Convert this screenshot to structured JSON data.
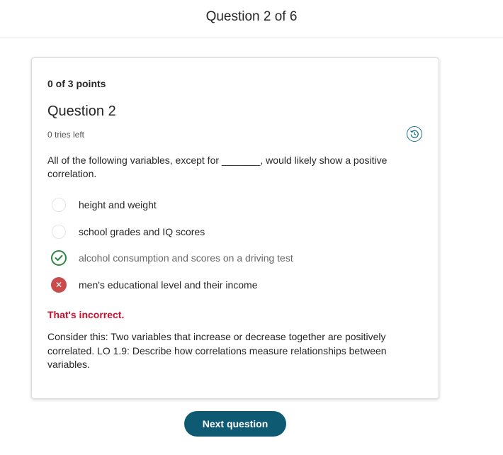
{
  "header": {
    "title": "Question 2 of 6"
  },
  "question": {
    "points": "0 of 3 points",
    "title": "Question 2",
    "tries": "0 tries left",
    "history_icon": "history-icon",
    "prompt": "All of the following variables, except for _______, would likely show a positive correlation.",
    "options": [
      {
        "label": "height and weight",
        "state": "unselected"
      },
      {
        "label": "school grades and IQ scores",
        "state": "unselected"
      },
      {
        "label": "alcohol consumption and scores on a driving test",
        "state": "correct-answer"
      },
      {
        "label": "men's educational level and their income",
        "state": "selected-incorrect"
      }
    ],
    "result": "That's incorrect.",
    "feedback": "Consider this: Two variables that increase or decrease together are positively correlated. LO 1.9: Describe how correlations measure relationships between variables."
  },
  "footer": {
    "next_label": "Next question"
  },
  "colors": {
    "accent": "#0e5a73",
    "correct": "#2e8540",
    "incorrect": "#c94b4b",
    "error_text": "#c8102e"
  }
}
